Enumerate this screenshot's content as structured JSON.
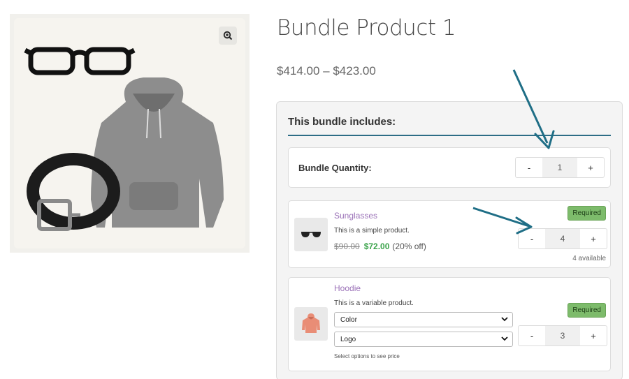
{
  "product": {
    "title": "Bundle Product 1",
    "price_range": "$414.00 – $423.00"
  },
  "gallery": {
    "zoom_icon": "zoom-in-icon",
    "image_alt": "glasses, hoodie and belt"
  },
  "bundle": {
    "heading": "This bundle includes:",
    "quantity_label": "Bundle Quantity:",
    "quantity": "1",
    "minus": "-",
    "plus": "+"
  },
  "items": [
    {
      "name": "Sunglasses",
      "description": "This is a simple product.",
      "old_price": "$90.00",
      "new_price": "$72.00",
      "discount": "(20% off)",
      "badge": "Required",
      "quantity": "4",
      "availability": "4 available",
      "thumb_icon": "sunglasses-icon"
    },
    {
      "name": "Hoodie",
      "description": "This is a variable product.",
      "badge": "Required",
      "quantity": "3",
      "select_color": "Color",
      "select_logo": "Logo",
      "hint": "Select options to see price",
      "thumb_icon": "hoodie-icon"
    }
  ],
  "colors": {
    "accent": "#2d6d86",
    "arrow": "#1f6e86",
    "sale": "#3aa34a",
    "badge": "#7dbb6b",
    "link": "#9b72b8"
  }
}
